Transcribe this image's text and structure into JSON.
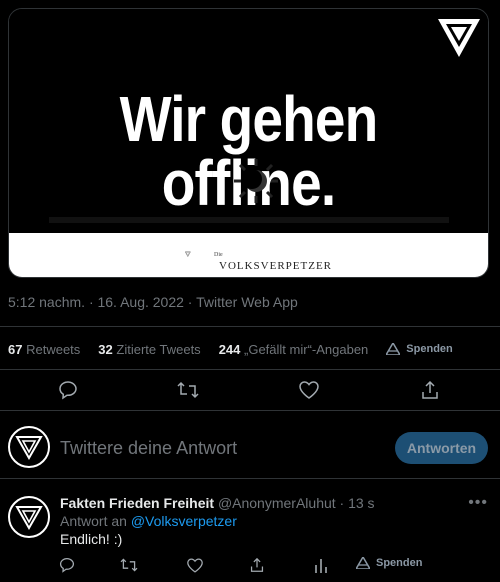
{
  "media": {
    "headline": "Wir gehen offline.",
    "brand_the": "Die",
    "brand_name": "VOLKSVERPETZER"
  },
  "tweet_meta": {
    "time": "5:12 nachm. · 16. Aug. 2022 · Twitter Web App"
  },
  "stats": {
    "retweets_count": "67",
    "retweets_label": "Retweets",
    "quotes_count": "32",
    "quotes_label": "Zitierte Tweets",
    "likes_count": "244",
    "likes_label": "„Gefällt mir“-Angaben",
    "spenden_label": "Spenden"
  },
  "reply_box": {
    "placeholder": "Twittere deine Antwort",
    "button_label": "Antworten"
  },
  "reply_tweet": {
    "name": "Fakten Frieden Freiheit",
    "handle_time": "@AnonymerAluhut · 13 s",
    "reply_to_prefix": "Antwort an",
    "reply_to_mention": "@Volksverpetzer",
    "text": "Endlich! :)",
    "spenden_label": "Spenden"
  },
  "colors": {
    "background": "#000000",
    "accent": "#1d9bf0",
    "muted": "#71767b",
    "reply_button_bg": "#1d4f74"
  },
  "icons": [
    "corner-triangle-logo",
    "moon-icon",
    "reply-icon",
    "retweet-icon",
    "like-icon",
    "share-icon",
    "analytics-icon",
    "spenden-icon",
    "more-icon",
    "avatar-logo"
  ]
}
